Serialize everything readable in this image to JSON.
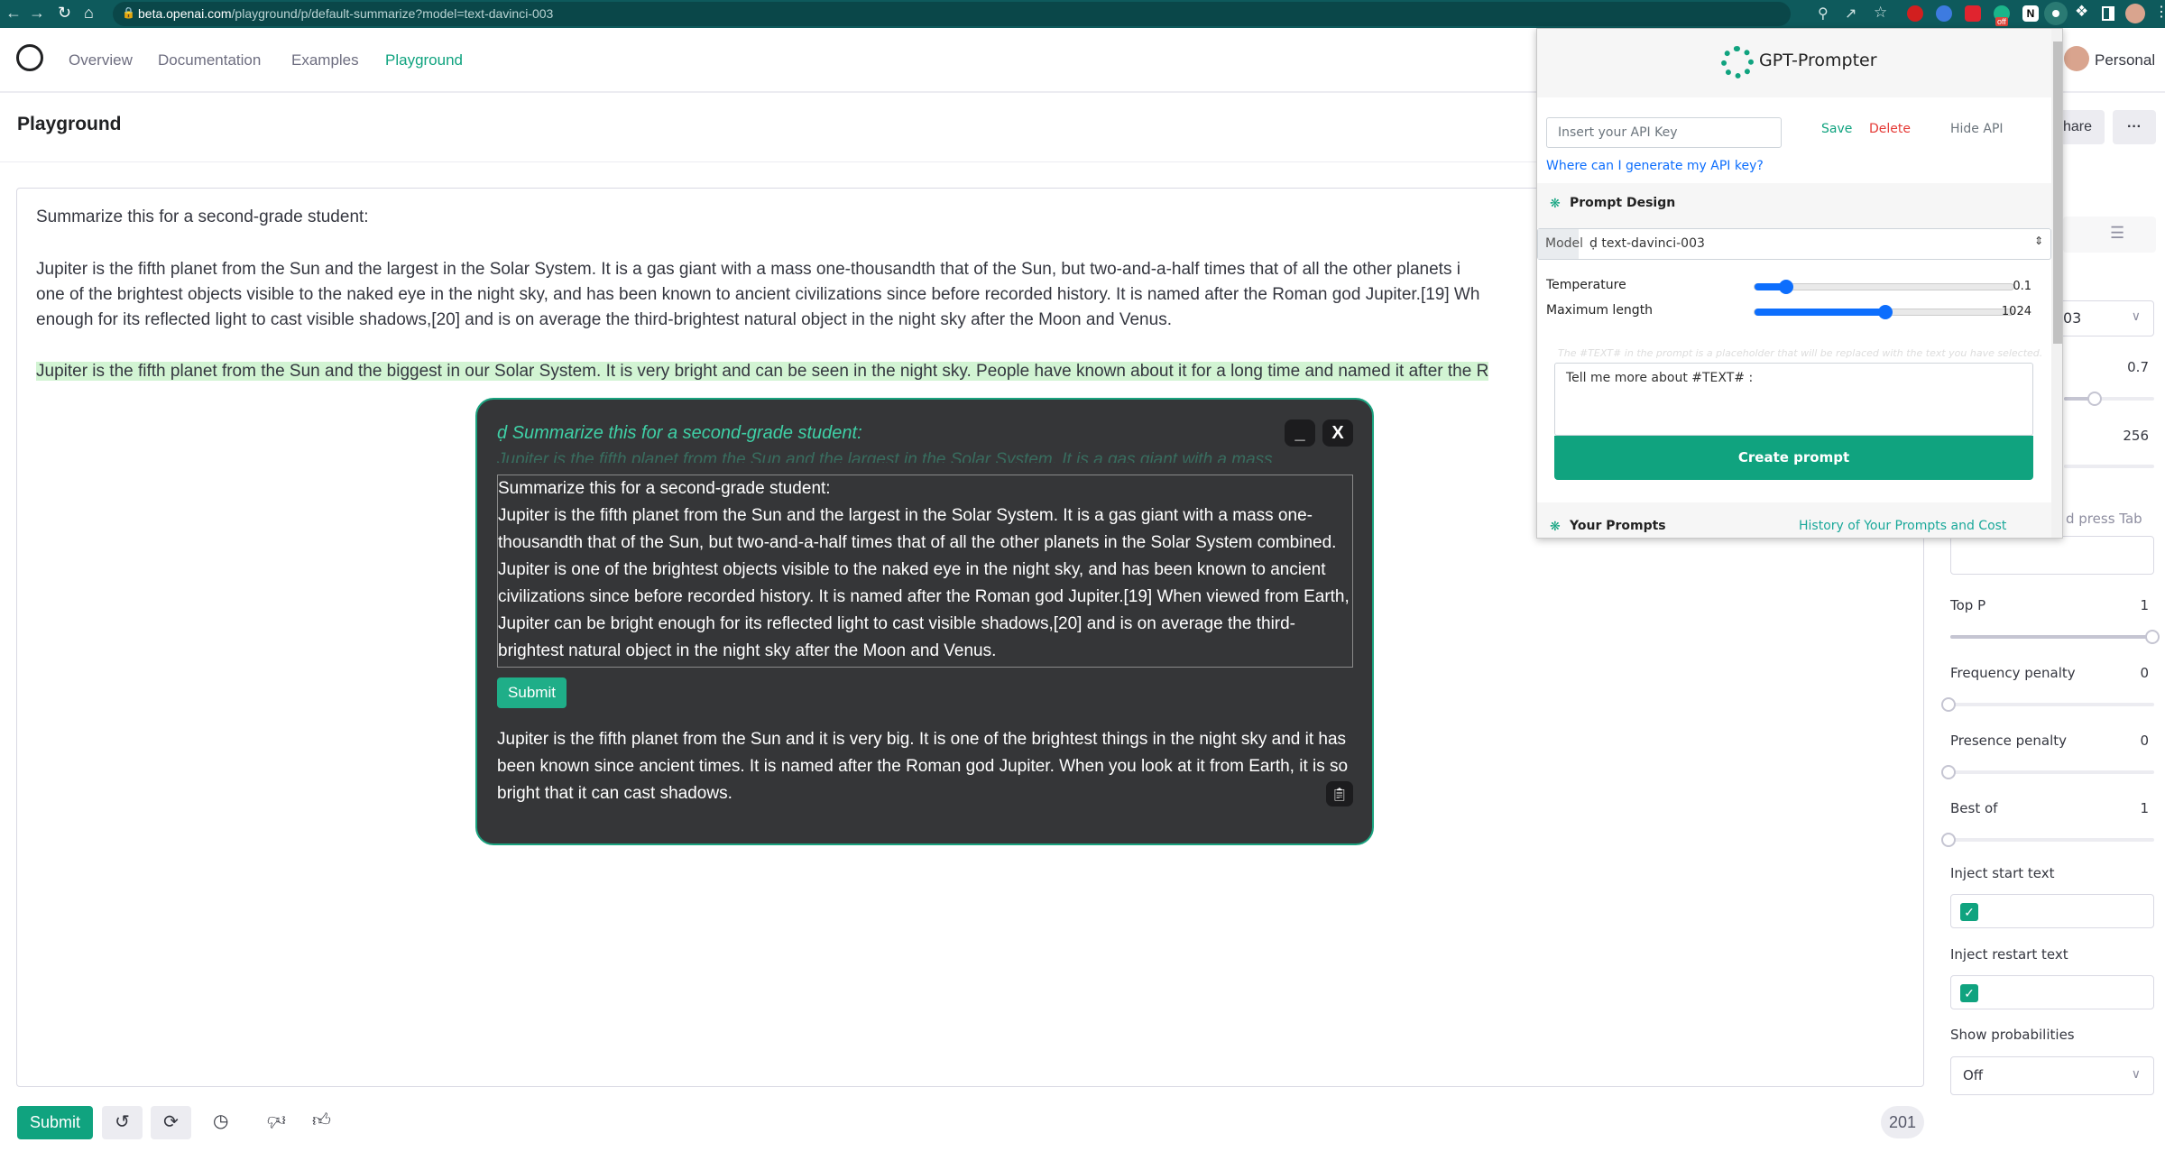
{
  "browser": {
    "url_host": "beta.openai.com",
    "url_path": "/playground/p/default-summarize?model=text-davinci-003",
    "extension_badge": "off"
  },
  "nav": {
    "items": [
      {
        "label": "Overview",
        "active": false
      },
      {
        "label": "Documentation",
        "active": false
      },
      {
        "label": "Examples",
        "active": false
      },
      {
        "label": "Playground",
        "active": true
      }
    ],
    "account_label": "Personal"
  },
  "page": {
    "title": "Playground",
    "share_label": "hare",
    "more_label": "···"
  },
  "editor": {
    "instruction": "Summarize this for a second-grade student:",
    "paragraph_lines": [
      "Jupiter is the fifth planet from the Sun and the largest in the Solar System. It is a gas giant with a mass one-thousandth that of the Sun, but two-and-a-half times that of all the other planets i",
      "one of the brightest objects visible to the naked eye in the night sky, and has been known to ancient civilizations since before recorded history. It is named after the Roman god Jupiter.[19] Wh",
      "enough for its reflected light to cast visible shadows,[20] and is on average the third-brightest natural object in the night sky after the Moon and Venus."
    ],
    "completion": "Jupiter is the fifth planet from the Sun and the biggest in our Solar System. It is very bright and can be seen in the night sky. People have known about it for a long time and named it after the R"
  },
  "bottom_bar": {
    "submit_label": "Submit",
    "token_count": "201"
  },
  "settings": {
    "model_value_partial": "03",
    "temperature_value": "0.7",
    "temperature_fraction": 0.7,
    "max_length_value": "256",
    "max_length_fraction": 0.06,
    "stop_hint_partial": "d press Tab",
    "top_p": {
      "label": "Top P",
      "value": "1",
      "fraction": 1
    },
    "frequency_penalty": {
      "label": "Frequency penalty",
      "value": "0",
      "fraction": 0
    },
    "presence_penalty": {
      "label": "Presence penalty",
      "value": "0",
      "fraction": 0
    },
    "best_of": {
      "label": "Best of",
      "value": "1",
      "fraction": 0
    },
    "inject_start": {
      "label": "Inject start text",
      "checked": true
    },
    "inject_restart": {
      "label": "Inject restart text",
      "checked": true
    },
    "show_probabilities": {
      "label": "Show probabilities",
      "value": "Off"
    }
  },
  "modal": {
    "title": "Summarize this for a second-grade student:",
    "faded_preview": "Jupiter is the fifth planet from the Sun and the largest in the Solar System. It is a gas giant with a mass",
    "minimize_label": "_",
    "close_label": "X",
    "input_lines": [
      " Summarize this for a second-grade student:",
      "Jupiter is the fifth planet from the Sun and the largest in the Solar System. It is a gas giant with a mass one-",
      "thousandth that of the Sun, but two-and-a-half times that of all the other planets in the Solar System combined.",
      "Jupiter is one of the brightest objects visible to the naked eye in the night sky, and has been known to ancient",
      "civilizations since before recorded history. It is named after the Roman god Jupiter.[19] When viewed from Earth,",
      "Jupiter can be bright enough for its reflected light to cast visible shadows,[20] and is on average the third-",
      "brightest natural object in the night sky after the Moon and Venus."
    ],
    "submit_label": "Submit",
    "output_lines": [
      "Jupiter is the fifth planet from the Sun and it is very big. It is one of the brightest things in the night sky and it has",
      "been known since ancient times. It is named after the Roman god Jupiter. When you look at it from Earth, it is so",
      "bright that it can cast shadows."
    ]
  },
  "popup": {
    "title": "GPT-Prompter",
    "api_key_placeholder": "Insert your API Key",
    "save_label": "Save",
    "delete_label": "Delete",
    "hide_api_label": "Hide API",
    "api_key_link": "Where can I generate my API key?",
    "prompt_design_heading": "Prompt Design",
    "model_label": "Model",
    "model_value": "text-davinci-003",
    "temperature_label": "Temperature",
    "temperature_value": "0.1",
    "temperature_fraction": 0.1,
    "max_length_label": "Maximum length",
    "max_length_value": "1024",
    "max_length_fraction": 0.5,
    "placeholder_hint": "The #TEXT# in the prompt is a placeholder that will be replaced with the text you have selected.",
    "prompt_text": "Tell me more about #TEXT# :",
    "create_prompt_label": "Create prompt",
    "your_prompts_heading": "Your Prompts",
    "history_link": "History of Your Prompts and Cost"
  },
  "colors": {
    "brand_green": "#10a37f",
    "chrome_teal": "#0e5a5c",
    "highlight": "#d2f4d3",
    "modal_bg": "#353638",
    "delete_red": "#e53935",
    "link_blue": "#0d6efd"
  }
}
